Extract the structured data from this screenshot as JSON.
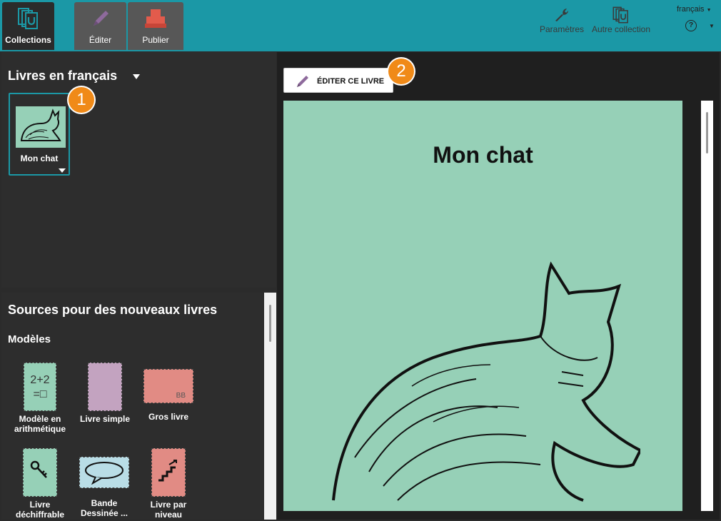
{
  "toolbar": {
    "tabs": [
      {
        "label": "Collections",
        "icon": "collections-icon"
      },
      {
        "label": "Éditer",
        "icon": "pencil-icon"
      },
      {
        "label": "Publier",
        "icon": "publish-icon"
      }
    ],
    "settings_label": "Paramètres",
    "other_collection_label": "Autre collection",
    "language": "français",
    "help": "?"
  },
  "collection": {
    "title": "Livres en français",
    "books": [
      {
        "name": "Mon chat"
      }
    ],
    "badge1": "1"
  },
  "sources": {
    "title": "Sources pour des nouveaux livres",
    "models_title": "Modèles",
    "templates": [
      {
        "label": "Modèle en arithmétique",
        "thumb_text": "2+2\n=□"
      },
      {
        "label": "Livre simple"
      },
      {
        "label": "Gros livre",
        "thumb_text": "BB"
      },
      {
        "label": "Livre déchiffrable"
      },
      {
        "label": "Bande Dessinée ..."
      },
      {
        "label": "Livre par niveau"
      }
    ]
  },
  "preview": {
    "edit_button": "ÉDITER CE LIVRE",
    "badge2": "2",
    "page_title": "Mon chat"
  },
  "colors": {
    "accent": "#1b98a6",
    "badge": "#f08a18",
    "page_bg": "#96d0b7"
  }
}
